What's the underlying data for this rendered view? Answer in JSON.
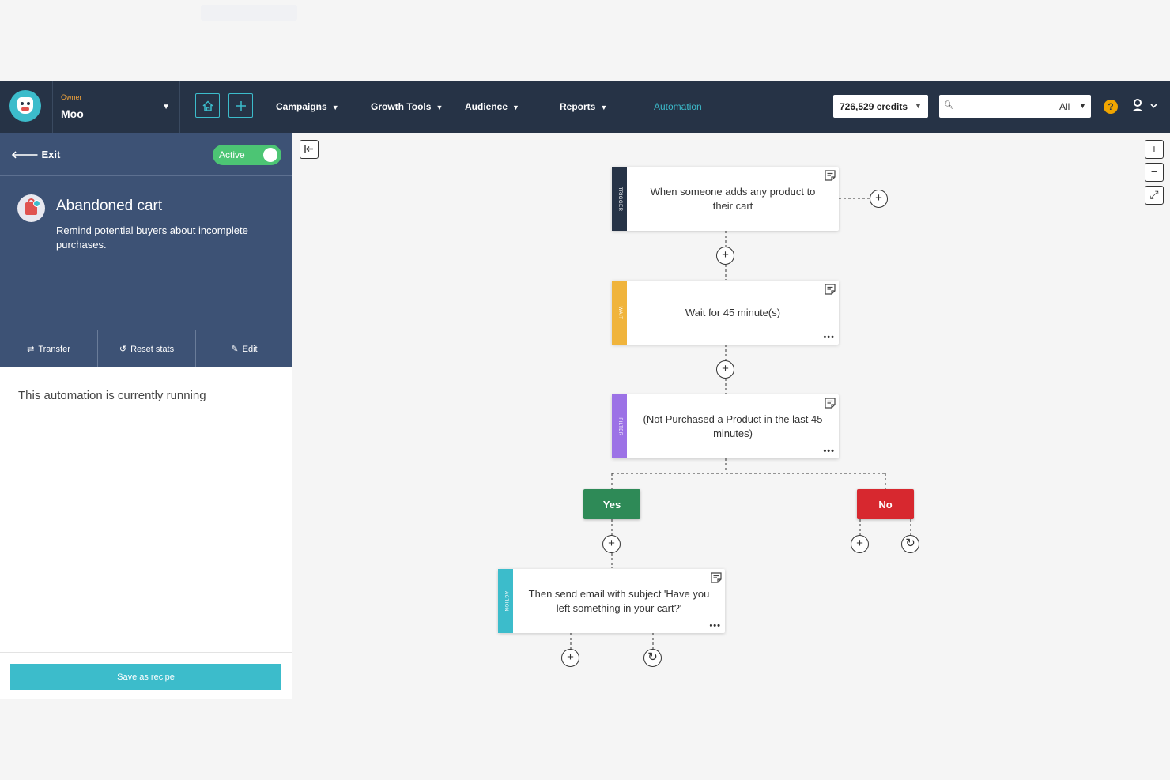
{
  "owner": {
    "label": "Owner",
    "name": "Moo"
  },
  "nav": {
    "menu": [
      "Campaigns",
      "Growth Tools",
      "Audience",
      "Reports",
      "Automation"
    ],
    "active": "Automation",
    "credits": "726,529 credits",
    "search": {
      "placeholder": "",
      "scope": "All"
    },
    "help": "?"
  },
  "panel": {
    "exit": "Exit",
    "status": "Active",
    "title": "Abandoned cart",
    "description": "Remind potential buyers about incomplete purchases.",
    "actions": [
      "Transfer",
      "Reset stats",
      "Edit"
    ],
    "running": "This automation is currently running",
    "save": "Save as recipe"
  },
  "flow": {
    "trigger": {
      "tag": "TRIGGER",
      "text": "When someone adds any product to their cart",
      "color": "#263346"
    },
    "wait": {
      "tag": "WAIT",
      "text": "Wait for 45 minute(s)",
      "color": "#f0b43c"
    },
    "filter": {
      "tag": "FILTER",
      "text": "(Not Purchased a Product in the last 45 minutes)",
      "color": "#9c72e6"
    },
    "yes": {
      "label": "Yes",
      "color": "#2e8a57"
    },
    "no": {
      "label": "No",
      "color": "#d7282f"
    },
    "action": {
      "tag": "ACTION",
      "text": "Then send email with subject 'Have you left something in your cart?'",
      "color": "#3cbccb"
    }
  }
}
